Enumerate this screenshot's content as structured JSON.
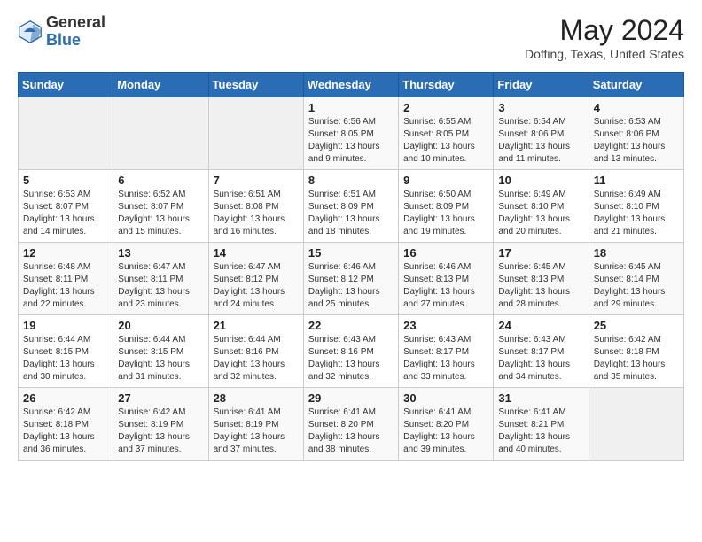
{
  "header": {
    "logo_general": "General",
    "logo_blue": "Blue",
    "month_year": "May 2024",
    "location": "Doffing, Texas, United States"
  },
  "days_of_week": [
    "Sunday",
    "Monday",
    "Tuesday",
    "Wednesday",
    "Thursday",
    "Friday",
    "Saturday"
  ],
  "weeks": [
    [
      {
        "day": "",
        "info": ""
      },
      {
        "day": "",
        "info": ""
      },
      {
        "day": "",
        "info": ""
      },
      {
        "day": "1",
        "info": "Sunrise: 6:56 AM\nSunset: 8:05 PM\nDaylight: 13 hours and 9 minutes."
      },
      {
        "day": "2",
        "info": "Sunrise: 6:55 AM\nSunset: 8:05 PM\nDaylight: 13 hours and 10 minutes."
      },
      {
        "day": "3",
        "info": "Sunrise: 6:54 AM\nSunset: 8:06 PM\nDaylight: 13 hours and 11 minutes."
      },
      {
        "day": "4",
        "info": "Sunrise: 6:53 AM\nSunset: 8:06 PM\nDaylight: 13 hours and 13 minutes."
      }
    ],
    [
      {
        "day": "5",
        "info": "Sunrise: 6:53 AM\nSunset: 8:07 PM\nDaylight: 13 hours and 14 minutes."
      },
      {
        "day": "6",
        "info": "Sunrise: 6:52 AM\nSunset: 8:07 PM\nDaylight: 13 hours and 15 minutes."
      },
      {
        "day": "7",
        "info": "Sunrise: 6:51 AM\nSunset: 8:08 PM\nDaylight: 13 hours and 16 minutes."
      },
      {
        "day": "8",
        "info": "Sunrise: 6:51 AM\nSunset: 8:09 PM\nDaylight: 13 hours and 18 minutes."
      },
      {
        "day": "9",
        "info": "Sunrise: 6:50 AM\nSunset: 8:09 PM\nDaylight: 13 hours and 19 minutes."
      },
      {
        "day": "10",
        "info": "Sunrise: 6:49 AM\nSunset: 8:10 PM\nDaylight: 13 hours and 20 minutes."
      },
      {
        "day": "11",
        "info": "Sunrise: 6:49 AM\nSunset: 8:10 PM\nDaylight: 13 hours and 21 minutes."
      }
    ],
    [
      {
        "day": "12",
        "info": "Sunrise: 6:48 AM\nSunset: 8:11 PM\nDaylight: 13 hours and 22 minutes."
      },
      {
        "day": "13",
        "info": "Sunrise: 6:47 AM\nSunset: 8:11 PM\nDaylight: 13 hours and 23 minutes."
      },
      {
        "day": "14",
        "info": "Sunrise: 6:47 AM\nSunset: 8:12 PM\nDaylight: 13 hours and 24 minutes."
      },
      {
        "day": "15",
        "info": "Sunrise: 6:46 AM\nSunset: 8:12 PM\nDaylight: 13 hours and 25 minutes."
      },
      {
        "day": "16",
        "info": "Sunrise: 6:46 AM\nSunset: 8:13 PM\nDaylight: 13 hours and 27 minutes."
      },
      {
        "day": "17",
        "info": "Sunrise: 6:45 AM\nSunset: 8:13 PM\nDaylight: 13 hours and 28 minutes."
      },
      {
        "day": "18",
        "info": "Sunrise: 6:45 AM\nSunset: 8:14 PM\nDaylight: 13 hours and 29 minutes."
      }
    ],
    [
      {
        "day": "19",
        "info": "Sunrise: 6:44 AM\nSunset: 8:15 PM\nDaylight: 13 hours and 30 minutes."
      },
      {
        "day": "20",
        "info": "Sunrise: 6:44 AM\nSunset: 8:15 PM\nDaylight: 13 hours and 31 minutes."
      },
      {
        "day": "21",
        "info": "Sunrise: 6:44 AM\nSunset: 8:16 PM\nDaylight: 13 hours and 32 minutes."
      },
      {
        "day": "22",
        "info": "Sunrise: 6:43 AM\nSunset: 8:16 PM\nDaylight: 13 hours and 32 minutes."
      },
      {
        "day": "23",
        "info": "Sunrise: 6:43 AM\nSunset: 8:17 PM\nDaylight: 13 hours and 33 minutes."
      },
      {
        "day": "24",
        "info": "Sunrise: 6:43 AM\nSunset: 8:17 PM\nDaylight: 13 hours and 34 minutes."
      },
      {
        "day": "25",
        "info": "Sunrise: 6:42 AM\nSunset: 8:18 PM\nDaylight: 13 hours and 35 minutes."
      }
    ],
    [
      {
        "day": "26",
        "info": "Sunrise: 6:42 AM\nSunset: 8:18 PM\nDaylight: 13 hours and 36 minutes."
      },
      {
        "day": "27",
        "info": "Sunrise: 6:42 AM\nSunset: 8:19 PM\nDaylight: 13 hours and 37 minutes."
      },
      {
        "day": "28",
        "info": "Sunrise: 6:41 AM\nSunset: 8:19 PM\nDaylight: 13 hours and 37 minutes."
      },
      {
        "day": "29",
        "info": "Sunrise: 6:41 AM\nSunset: 8:20 PM\nDaylight: 13 hours and 38 minutes."
      },
      {
        "day": "30",
        "info": "Sunrise: 6:41 AM\nSunset: 8:20 PM\nDaylight: 13 hours and 39 minutes."
      },
      {
        "day": "31",
        "info": "Sunrise: 6:41 AM\nSunset: 8:21 PM\nDaylight: 13 hours and 40 minutes."
      },
      {
        "day": "",
        "info": ""
      }
    ]
  ]
}
